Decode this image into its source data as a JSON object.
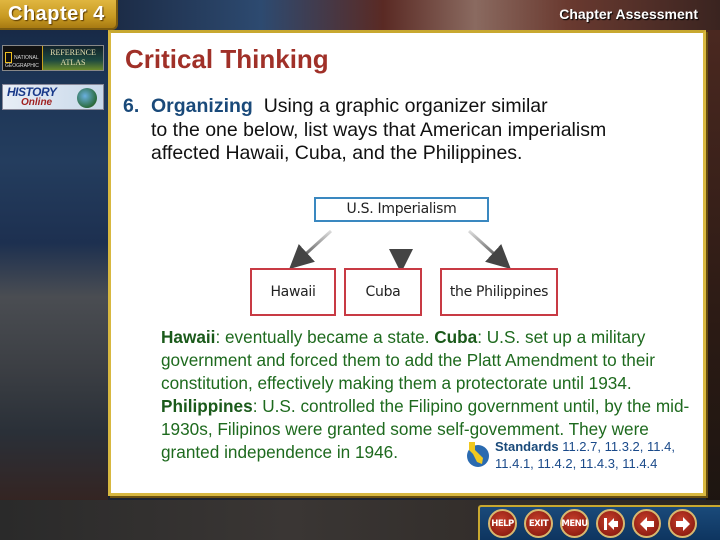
{
  "header": {
    "chapter_label": "Chapter 4",
    "section_label": "Chapter Assessment"
  },
  "sidebar": {
    "national_geographic": "NATIONAL GEOGRAPHIC",
    "reference_atlas_line1": "REFERENCE",
    "reference_atlas_line2": "ATLAS",
    "history_label": "HISTORY",
    "online_label": "Online"
  },
  "slide": {
    "title": "Critical Thinking",
    "question": {
      "number": "6.",
      "keyword": "Organizing",
      "text_first": "Using a graphic organizer similar",
      "text_rest": "to the one below, list ways that American imperialism affected Hawaii, Cuba, and the Philippines."
    },
    "organizer": {
      "root": "U.S. Imperialism",
      "leaves": [
        "Hawaii",
        "Cuba",
        "the Philippines"
      ],
      "root_color": "#3a88c0",
      "leaf_color": "#c83a44"
    },
    "answer": {
      "hawaii_label": "Hawaii",
      "hawaii_text": ": eventually became a state. ",
      "cuba_label": "Cuba",
      "cuba_text": ": U.S. set up a military government and forced them to add the Platt Amendment to their constitution, effectively making them a protectorate until 1934. ",
      "philippines_label": "Philippines",
      "philippines_text": ": U.S. controlled the Filipino government until, by the mid-1930s, Filipinos were granted some self-govemment. They were granted independence in 1946."
    },
    "standards": {
      "label": "Standards",
      "codes": "11.2.7, 11.3.2, 11.4, 11.4.1, 11.4.2, 11.4.3, 11.4.4"
    }
  },
  "navigation": {
    "help": "HELP",
    "exit": "EXIT",
    "menu": "MENU",
    "first": "first-slide",
    "previous": "previous-slide",
    "next": "next-slide"
  },
  "colors": {
    "title": "#a03028",
    "keyword": "#1a4a7a",
    "answer": "#1e6a1e",
    "panel_border": "#d8b840"
  }
}
